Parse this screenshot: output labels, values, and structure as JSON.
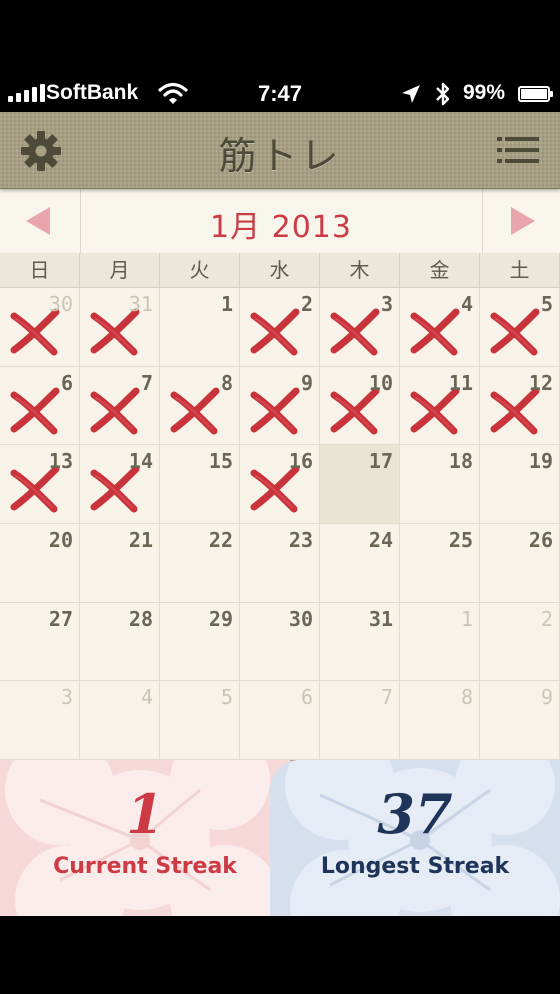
{
  "status_bar": {
    "carrier": "SoftBank",
    "time": "7:47",
    "battery": "99%",
    "battery_level": 0.99
  },
  "nav": {
    "title": "筋トレ",
    "left_icon": "gear-icon",
    "right_icon": "list-icon"
  },
  "calendar": {
    "month_title": "1月 2013",
    "weekdays": [
      "日",
      "月",
      "火",
      "水",
      "木",
      "金",
      "土"
    ],
    "days": [
      {
        "n": "30",
        "out": true,
        "x": true
      },
      {
        "n": "31",
        "out": true,
        "x": true
      },
      {
        "n": "1",
        "out": false,
        "x": false
      },
      {
        "n": "2",
        "out": false,
        "x": true
      },
      {
        "n": "3",
        "out": false,
        "x": true
      },
      {
        "n": "4",
        "out": false,
        "x": true
      },
      {
        "n": "5",
        "out": false,
        "x": true
      },
      {
        "n": "6",
        "out": false,
        "x": true
      },
      {
        "n": "7",
        "out": false,
        "x": true
      },
      {
        "n": "8",
        "out": false,
        "x": true
      },
      {
        "n": "9",
        "out": false,
        "x": true
      },
      {
        "n": "10",
        "out": false,
        "x": true
      },
      {
        "n": "11",
        "out": false,
        "x": true
      },
      {
        "n": "12",
        "out": false,
        "x": true
      },
      {
        "n": "13",
        "out": false,
        "x": true
      },
      {
        "n": "14",
        "out": false,
        "x": true
      },
      {
        "n": "15",
        "out": false,
        "x": false
      },
      {
        "n": "16",
        "out": false,
        "x": true
      },
      {
        "n": "17",
        "out": false,
        "x": false,
        "today": true
      },
      {
        "n": "18",
        "out": false,
        "x": false
      },
      {
        "n": "19",
        "out": false,
        "x": false
      },
      {
        "n": "20",
        "out": false,
        "x": false
      },
      {
        "n": "21",
        "out": false,
        "x": false
      },
      {
        "n": "22",
        "out": false,
        "x": false
      },
      {
        "n": "23",
        "out": false,
        "x": false
      },
      {
        "n": "24",
        "out": false,
        "x": false
      },
      {
        "n": "25",
        "out": false,
        "x": false
      },
      {
        "n": "26",
        "out": false,
        "x": false
      },
      {
        "n": "27",
        "out": false,
        "x": false
      },
      {
        "n": "28",
        "out": false,
        "x": false
      },
      {
        "n": "29",
        "out": false,
        "x": false
      },
      {
        "n": "30",
        "out": false,
        "x": false
      },
      {
        "n": "31",
        "out": false,
        "x": false
      },
      {
        "n": "1",
        "out": true,
        "x": false
      },
      {
        "n": "2",
        "out": true,
        "x": false
      },
      {
        "n": "3",
        "out": true,
        "x": false
      },
      {
        "n": "4",
        "out": true,
        "x": false
      },
      {
        "n": "5",
        "out": true,
        "x": false
      },
      {
        "n": "6",
        "out": true,
        "x": false
      },
      {
        "n": "7",
        "out": true,
        "x": false
      },
      {
        "n": "8",
        "out": true,
        "x": false
      },
      {
        "n": "9",
        "out": true,
        "x": false
      }
    ]
  },
  "streaks": {
    "current_value": "1",
    "current_label": "Current Streak",
    "longest_value": "37",
    "longest_label": "Longest Streak"
  },
  "colors": {
    "accent_red": "#cc3b44",
    "navy": "#1f3459",
    "nav_bg": "#a79f82"
  }
}
